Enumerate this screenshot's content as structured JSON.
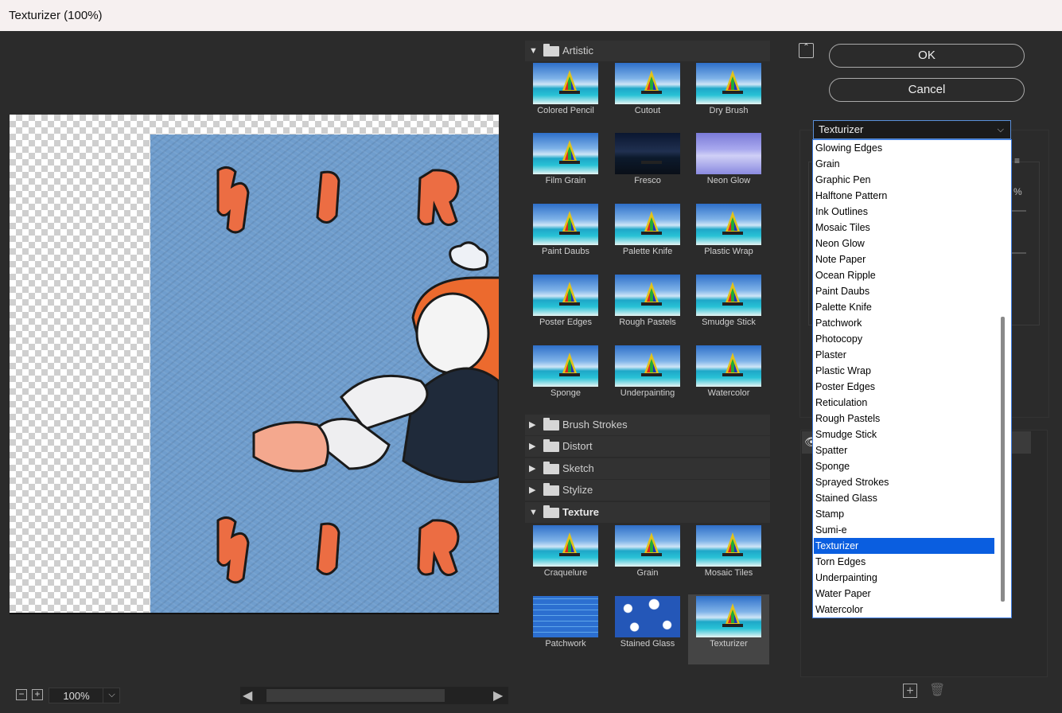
{
  "window": {
    "title": "Texturizer (100%)"
  },
  "preview": {
    "zoom": "100%",
    "zoom_out_label": "−",
    "zoom_in_label": "+",
    "zoom_caret": "⌵",
    "scroll_left": "◀",
    "scroll_right": "▶"
  },
  "gallery": {
    "categories": [
      {
        "label": "Artistic",
        "expanded": true,
        "triangle": "▼"
      },
      {
        "label": "Brush Strokes",
        "expanded": false,
        "triangle": "▶"
      },
      {
        "label": "Distort",
        "expanded": false,
        "triangle": "▶"
      },
      {
        "label": "Sketch",
        "expanded": false,
        "triangle": "▶"
      },
      {
        "label": "Stylize",
        "expanded": false,
        "triangle": "▶"
      },
      {
        "label": "Texture",
        "expanded": true,
        "triangle": "▼"
      }
    ],
    "artistic": [
      "Colored Pencil",
      "Cutout",
      "Dry Brush",
      "Film Grain",
      "Fresco",
      "Neon Glow",
      "Paint Daubs",
      "Palette Knife",
      "Plastic Wrap",
      "Poster Edges",
      "Rough Pastels",
      "Smudge Stick",
      "Sponge",
      "Underpainting",
      "Watercolor"
    ],
    "texture": [
      "Craquelure",
      "Grain",
      "Mosaic Tiles",
      "Patchwork",
      "Stained Glass",
      "Texturizer"
    ],
    "selected": "Texturizer"
  },
  "buttons": {
    "ok": "OK",
    "cancel": "Cancel",
    "collapse_icon": "⌃"
  },
  "filter_select": {
    "value": "Texturizer",
    "chevron": "⌵",
    "options": [
      "Glowing Edges",
      "Grain",
      "Graphic Pen",
      "Halftone Pattern",
      "Ink Outlines",
      "Mosaic Tiles",
      "Neon Glow",
      "Note Paper",
      "Ocean Ripple",
      "Paint Daubs",
      "Palette Knife",
      "Patchwork",
      "Photocopy",
      "Plaster",
      "Plastic Wrap",
      "Poster Edges",
      "Reticulation",
      "Rough Pastels",
      "Smudge Stick",
      "Spatter",
      "Sponge",
      "Sprayed Strokes",
      "Stained Glass",
      "Stamp",
      "Sumi-e",
      "Texturizer",
      "Torn Edges",
      "Underpainting",
      "Water Paper",
      "Watercolor"
    ],
    "selected_index": 25
  },
  "settings_peek": {
    "percent": "%",
    "menu_icon": "≡"
  },
  "layers": {
    "eye_icon": "👁",
    "new_layer_icon": "+",
    "delete_icon": "🗑"
  }
}
